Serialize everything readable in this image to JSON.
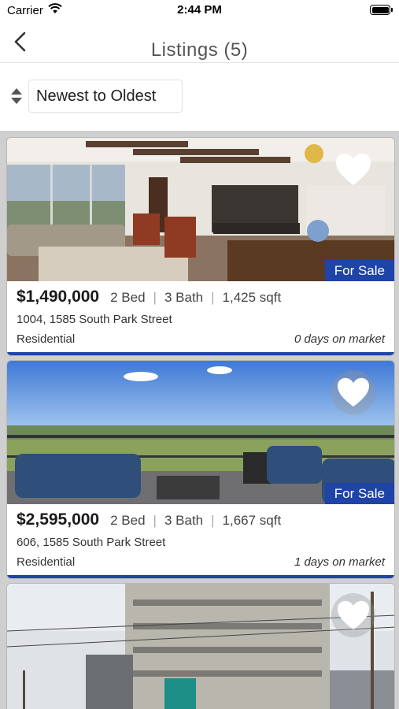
{
  "status": {
    "carrier": "Carrier",
    "time": "2:44 PM"
  },
  "nav": {
    "title": "Listings (5)"
  },
  "sort": {
    "selected": "Newest to Oldest"
  },
  "colors": {
    "accent": "#1e44a8"
  },
  "listings": [
    {
      "price": "$1,490,000",
      "beds": "2 Bed",
      "baths": "3 Bath",
      "sqft": "1,425 sqft",
      "address": "1004, 1585 South Park Street",
      "type": "Residential",
      "days": "0 days on market",
      "status": "For Sale"
    },
    {
      "price": "$2,595,000",
      "beds": "2 Bed",
      "baths": "3 Bath",
      "sqft": "1,667 sqft",
      "address": "606, 1585 South Park Street",
      "type": "Residential",
      "days": "1 days on market",
      "status": "For Sale"
    }
  ]
}
